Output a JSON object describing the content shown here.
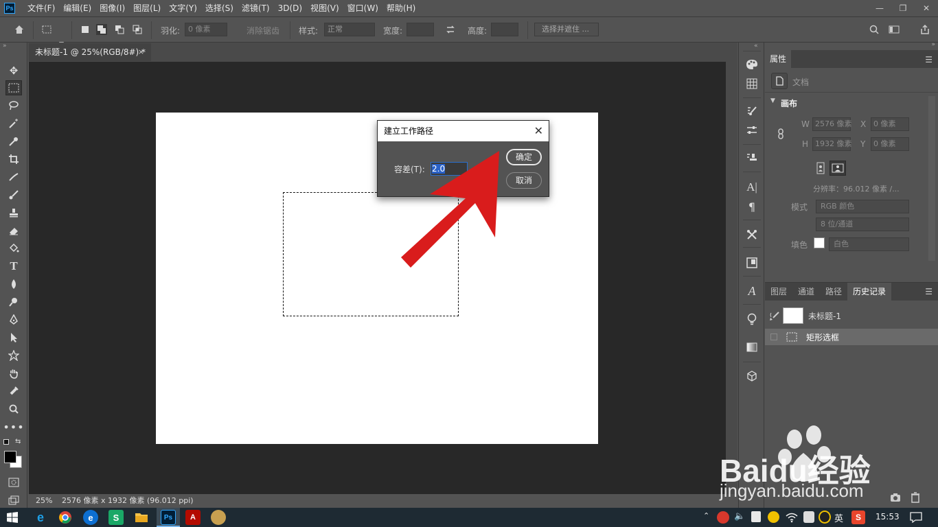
{
  "app": {
    "logo": "Ps"
  },
  "menu": [
    "文件(F)",
    "编辑(E)",
    "图像(I)",
    "图层(L)",
    "文字(Y)",
    "选择(S)",
    "滤镜(T)",
    "3D(D)",
    "视图(V)",
    "窗口(W)",
    "帮助(H)"
  ],
  "options": {
    "feather_label": "羽化:",
    "feather_value": "0 像素",
    "antialias_label": "消除锯齿",
    "style_label": "样式:",
    "style_value": "正常",
    "width_label": "宽度:",
    "height_label": "高度:",
    "select_mask_button": "选择并遮住 ..."
  },
  "document": {
    "tab_title": "未标题-1 @ 25%(RGB/8#) *",
    "tab_close": "×",
    "status_zoom": "25%",
    "status_info": "2576 像素 x 1932 像素 (96.012 ppi)"
  },
  "dialog": {
    "title": "建立工作路径",
    "close": "✕",
    "tolerance_label": "容差(T):",
    "tolerance_value": "2.0",
    "ok_button": "确定",
    "cancel_button": "取消"
  },
  "properties": {
    "tab": "属性",
    "doc_label": "文档",
    "section": "画布",
    "w_label": "W",
    "w_value": "2576 像素",
    "h_label": "H",
    "h_value": "1932 像素",
    "x_label": "X",
    "x_value": "0 像素",
    "y_label": "Y",
    "y_value": "0 像素",
    "resolution": "分辨率：96.012 像素 /...",
    "mode_label": "模式",
    "mode_value": "RGB 颜色",
    "depth_value": "8 位/通道",
    "fill_label": "填色",
    "fill_value": "白色"
  },
  "history": {
    "tabs": [
      "图层",
      "通道",
      "路径",
      "历史记录"
    ],
    "snapshot_name": "未标题-1",
    "step_name": "矩形选框"
  },
  "taskbar": {
    "ime": "英",
    "time": "15:53"
  },
  "watermark": {
    "brand": "Baidu经验",
    "url": "jingyan.baidu.com"
  },
  "colors": {
    "accent": "#31a8ff",
    "arrow": "#d91c1c",
    "panel": "#535353",
    "workspace": "#282828"
  }
}
